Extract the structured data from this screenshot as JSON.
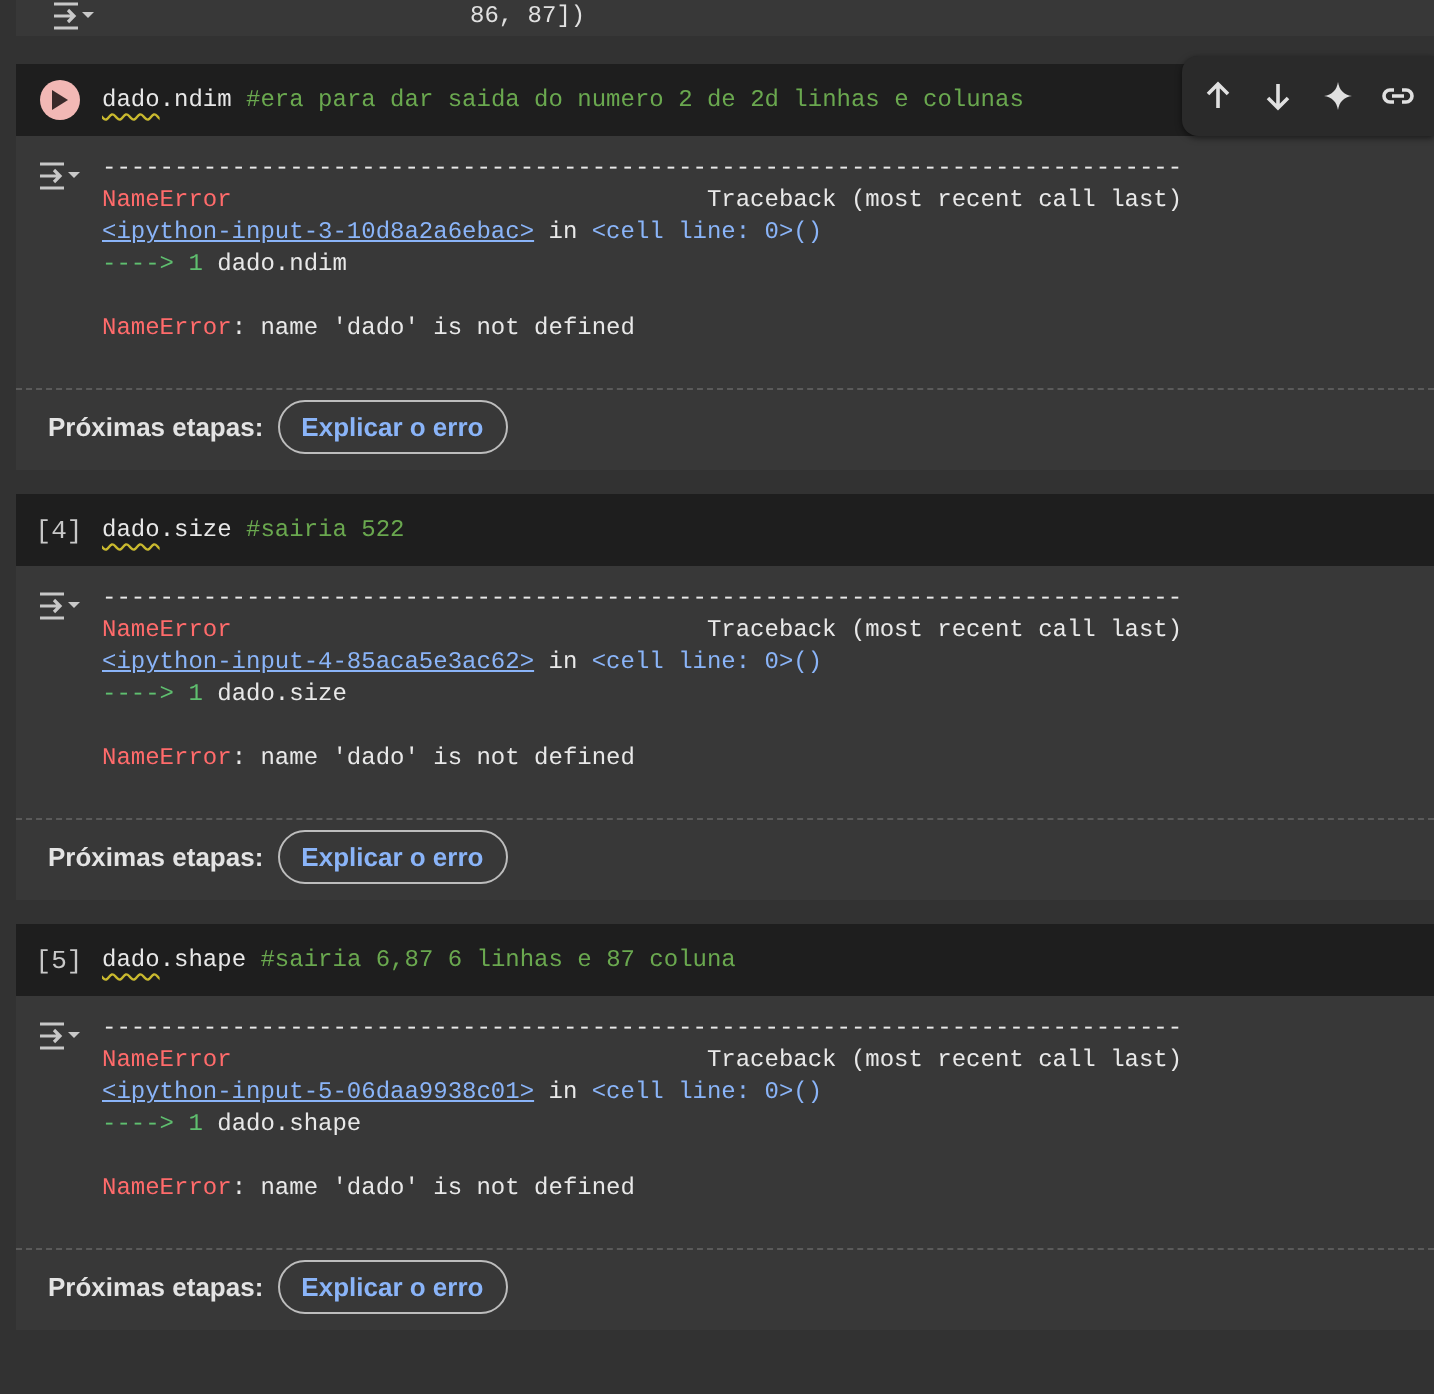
{
  "top_output": {
    "text": "86, 87])"
  },
  "toolbar": [
    {
      "kind": "up"
    },
    {
      "kind": "down"
    },
    {
      "kind": "sparkle"
    },
    {
      "kind": "link"
    }
  ],
  "cells": [
    {
      "selected": true,
      "code": {
        "name": "dado",
        "warning": true,
        "attribute": ".ndim",
        "comment": "#era para dar saida do numero 2 de 2d linhas e colunas"
      },
      "output": {
        "separator": "---------------------------------------------------------------------------",
        "error_name": "NameError",
        "traceback_header": "Traceback (most recent call last)",
        "source_link": "<ipython-input-3-10d8a2a6ebac>",
        "in_text": "in",
        "location": "<cell line: 0>()",
        "arrow": "---->",
        "line_number": "1",
        "source_code": "dado.ndim",
        "final_error_name": "NameError",
        "message": ": name 'dado' is not defined"
      },
      "next_steps": {
        "label": "Próximas etapas:",
        "button": "Explicar o erro"
      }
    },
    {
      "selected": false,
      "count": "[4]",
      "code": {
        "name": "dado",
        "warning": true,
        "attribute": ".size",
        "comment": "#sairia 522"
      },
      "output": {
        "separator": "---------------------------------------------------------------------------",
        "error_name": "NameError",
        "traceback_header": "Traceback (most recent call last)",
        "source_link": "<ipython-input-4-85aca5e3ac62>",
        "in_text": "in",
        "location": "<cell line: 0>()",
        "arrow": "---->",
        "line_number": "1",
        "source_code": "dado.size",
        "final_error_name": "NameError",
        "message": ": name 'dado' is not defined"
      },
      "next_steps": {
        "label": "Próximas etapas:",
        "button": "Explicar o erro"
      }
    },
    {
      "selected": false,
      "count": "[5]",
      "code": {
        "name": "dado",
        "warning": true,
        "attribute": ".shape",
        "comment": "#sairia 6,87 6 linhas e 87 coluna"
      },
      "output": {
        "separator": "---------------------------------------------------------------------------",
        "error_name": "NameError",
        "traceback_header": "Traceback (most recent call last)",
        "source_link": "<ipython-input-5-06daa9938c01>",
        "in_text": "in",
        "location": "<cell line: 0>()",
        "arrow": "---->",
        "line_number": "1",
        "source_code": "dado.shape",
        "final_error_name": "NameError",
        "message": ": name 'dado' is not defined"
      },
      "next_steps": {
        "label": "Próximas etapas:",
        "button": "Explicar o erro"
      }
    }
  ]
}
